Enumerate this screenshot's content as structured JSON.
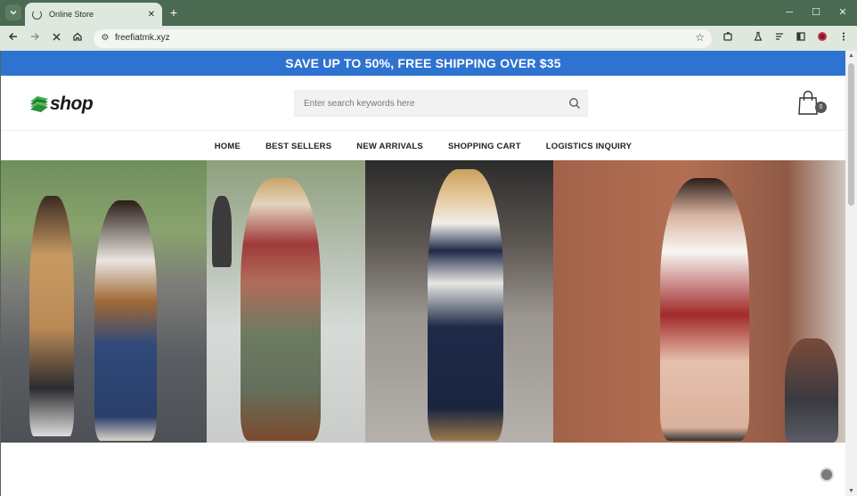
{
  "browser": {
    "tab_title": "Online Store",
    "url": "freefiatmk.xyz",
    "theme_color": "#4b6a52"
  },
  "promo": {
    "text": "SAVE UP TO 50%, FREE SHIPPING OVER $35",
    "background": "#2f73d0"
  },
  "header": {
    "logo_text": "shop",
    "search_placeholder": "Enter search keywords here",
    "cart_count": "0"
  },
  "nav": {
    "items": [
      "HOME",
      "BEST SELLERS",
      "NEW ARRIVALS",
      "SHOPPING CART",
      "LOGISTICS INQUIRY"
    ]
  },
  "icons": {
    "tab_menu": "chevron-down-icon",
    "spinner": "loading-icon",
    "close": "close-icon",
    "new_tab": "plus-icon",
    "back": "back-arrow-icon",
    "forward": "forward-arrow-icon",
    "stop": "stop-icon",
    "home": "home-icon",
    "site_info": "site-info-icon",
    "bookmark": "star-icon",
    "extensions": "puzzle-icon",
    "search": "search-icon",
    "cart": "shopping-bag-icon"
  }
}
